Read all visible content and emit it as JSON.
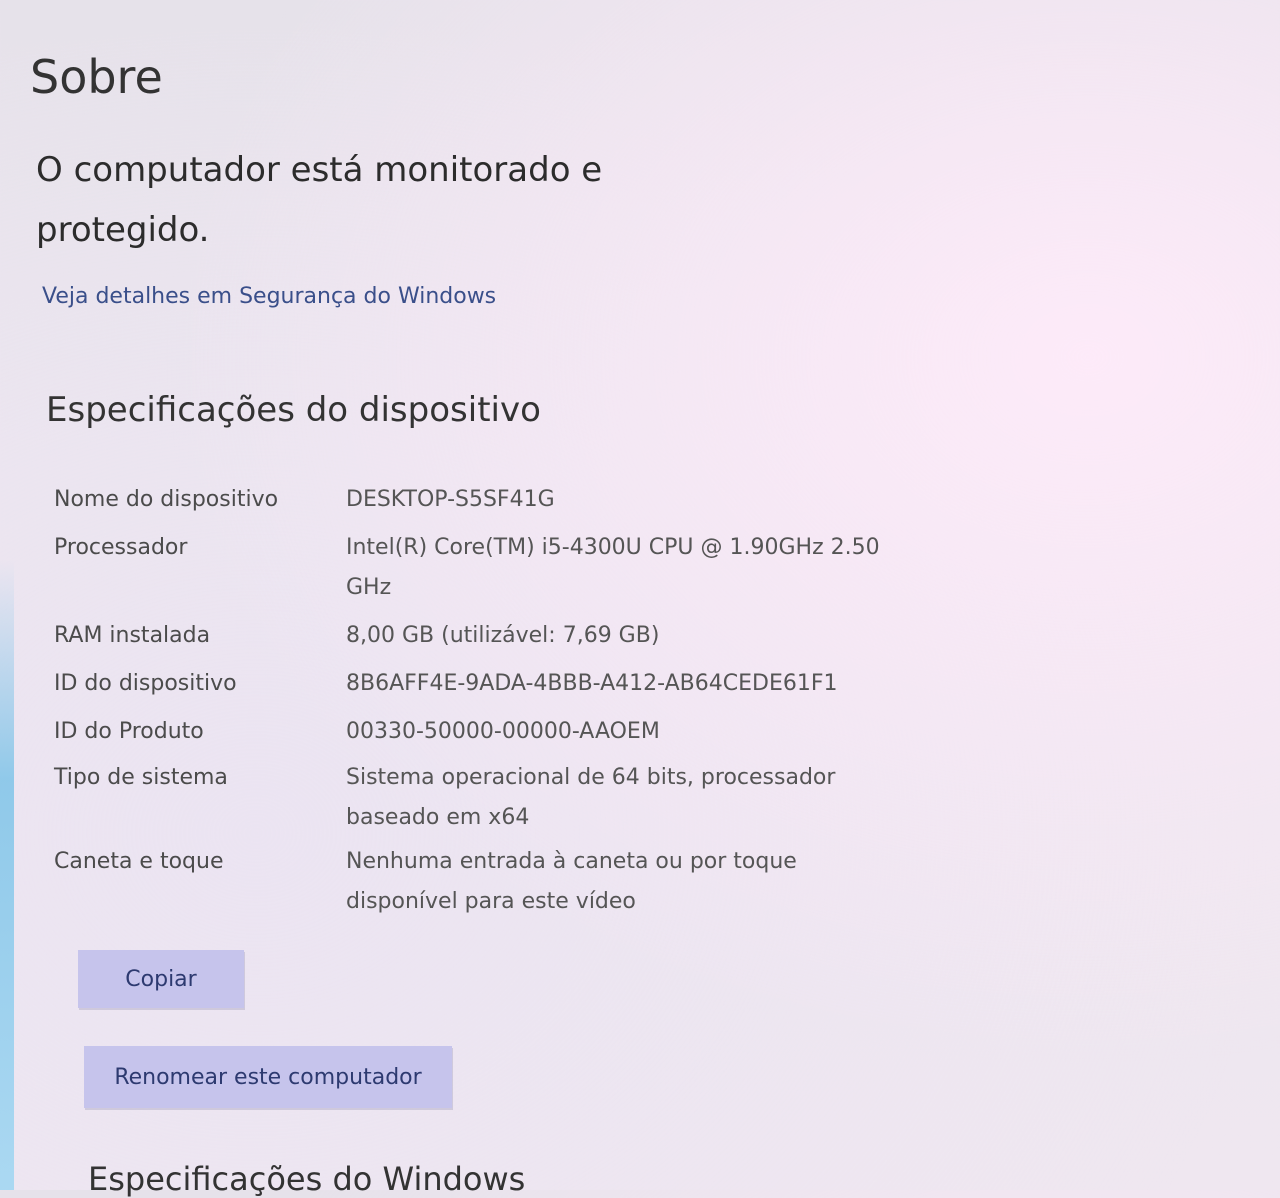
{
  "page": {
    "title": "Sobre"
  },
  "protection": {
    "status": "O computador está monitorado e protegido.",
    "link": "Veja detalhes em Segurança do Windows"
  },
  "device_specs": {
    "title": "Especificações do dispositivo",
    "rows": [
      {
        "label": "Nome do dispositivo",
        "value": "DESKTOP-S5SF41G"
      },
      {
        "label": "Processador",
        "value": "Intel(R) Core(TM) i5-4300U CPU @ 1.90GHz 2.50 GHz"
      },
      {
        "label": "RAM instalada",
        "value": "8,00 GB (utilizável: 7,69 GB)"
      },
      {
        "label": "ID do dispositivo",
        "value": "8B6AFF4E-9ADA-4BBB-A412-AB64CEDE61F1"
      },
      {
        "label": "ID do Produto",
        "value": "00330-50000-00000-AAOEM"
      },
      {
        "label": "Tipo de sistema",
        "value": "Sistema operacional de 64 bits, processador baseado em x64"
      },
      {
        "label": "Caneta e toque",
        "value": "Nenhuma entrada à caneta ou por toque disponível para este vídeo"
      }
    ],
    "copy_button": "Copiar",
    "rename_button": "Renomear este computador"
  },
  "windows_specs": {
    "title": "Especificações do Windows"
  }
}
